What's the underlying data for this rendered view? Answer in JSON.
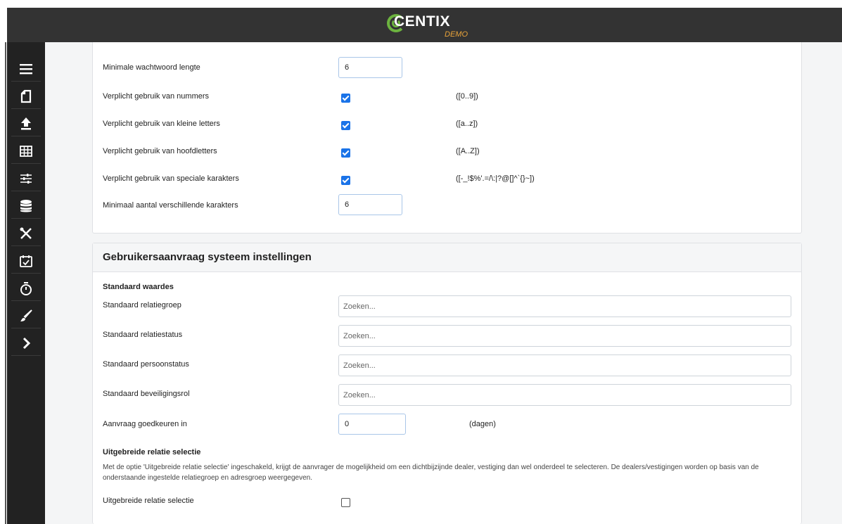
{
  "header": {
    "logo_text": "CENTIX",
    "logo_sub": "DEMO"
  },
  "sidebar": {
    "items": [
      {
        "icon": "hamburger-menu-icon"
      },
      {
        "icon": "document-icon"
      },
      {
        "icon": "upload-icon"
      },
      {
        "icon": "table-grid-icon"
      },
      {
        "icon": "sliders-icon"
      },
      {
        "icon": "database-icon"
      },
      {
        "icon": "tools-icon"
      },
      {
        "icon": "calendar-check-icon"
      },
      {
        "icon": "stopwatch-icon"
      },
      {
        "icon": "paintbrush-icon"
      },
      {
        "icon": "chevron-right-icon"
      }
    ]
  },
  "password_settings": {
    "min_length": {
      "label": "Minimale wachtwoord lengte",
      "value": "6"
    },
    "require_numbers": {
      "label": "Verplicht gebruik van nummers",
      "checked": true,
      "hint": "([0..9])"
    },
    "require_lowercase": {
      "label": "Verplicht gebruik van kleine letters",
      "checked": true,
      "hint": "([a..z])"
    },
    "require_uppercase": {
      "label": "Verplicht gebruik van hoofdletters",
      "checked": true,
      "hint": "([A..Z])"
    },
    "require_special": {
      "label": "Verplicht gebruik van speciale karakters",
      "checked": true,
      "hint": "([-_!$%'.=/\\:|?@[]^`{}~])"
    },
    "min_distinct": {
      "label": "Minimaal aantal verschillende karakters",
      "value": "6"
    }
  },
  "request_settings": {
    "title": "Gebruikersaanvraag systeem instellingen",
    "defaults_heading": "Standaard waardes",
    "relation_group": {
      "label": "Standaard relatiegroep",
      "placeholder": "Zoeken..."
    },
    "relation_status": {
      "label": "Standaard relatiestatus",
      "placeholder": "Zoeken..."
    },
    "person_status": {
      "label": "Standaard persoonstatus",
      "placeholder": "Zoeken..."
    },
    "security_role": {
      "label": "Standaard beveiligingsrol",
      "placeholder": "Zoeken..."
    },
    "approve_in": {
      "label": "Aanvraag goedkeuren in",
      "value": "0",
      "unit": "(dagen)"
    },
    "extended_heading": "Uitgebreide relatie selectie",
    "extended_desc": "Met de optie 'Uitgebreide relatie selectie' ingeschakeld, krijgt de aanvrager de mogelijkheid om een dichtbijzijnde dealer, vestiging dan wel onderdeel te selecteren. De dealers/vestigingen worden op basis van de onderstaande ingestelde relatiegroep en adresgroep weergegeven.",
    "extended_toggle": {
      "label": "Uitgebreide relatie selectie",
      "checked": false
    }
  },
  "colors": {
    "accent": "#1a73e8",
    "sidebar_bg": "#222222",
    "topbar_bg": "#333333",
    "logo_green": "#6cb33f",
    "logo_orange": "#e8a33a"
  }
}
